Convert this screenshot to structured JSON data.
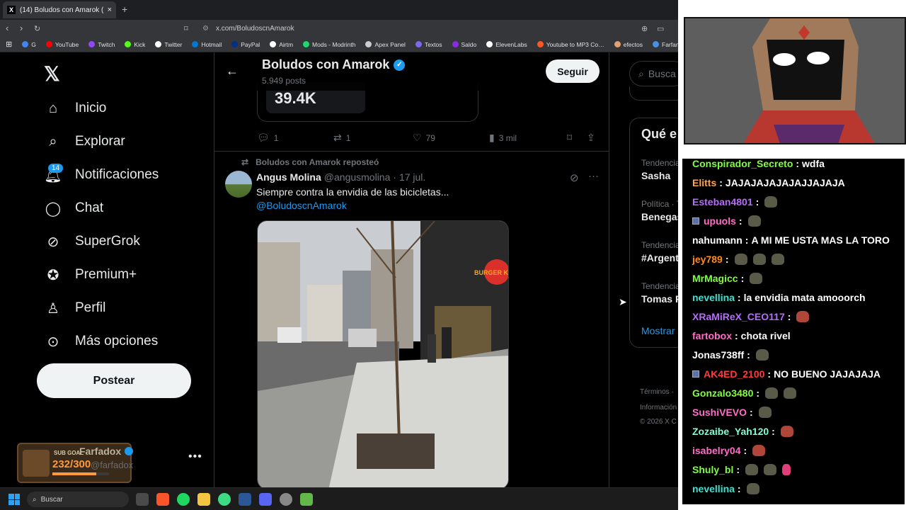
{
  "browser": {
    "tab_title": "(14) Boludos con Amarok (@Bol…",
    "tab_close": "×",
    "new_tab": "+",
    "url": "x.com/BoludoscnAmarok",
    "bookmarks": [
      {
        "label": "G",
        "color": "#4285f4"
      },
      {
        "label": "YouTube",
        "color": "#ff0000"
      },
      {
        "label": "Twitch",
        "color": "#9146ff"
      },
      {
        "label": "Kick",
        "color": "#53fc18"
      },
      {
        "label": "Twitter",
        "color": "#ffffff"
      },
      {
        "label": "Hotmail",
        "color": "#0078d4"
      },
      {
        "label": "PayPal",
        "color": "#003087"
      },
      {
        "label": "Airtm",
        "color": "#ffffff"
      },
      {
        "label": "Mods - Modrinth",
        "color": "#1bd96a"
      },
      {
        "label": "Apex Panel",
        "color": "#cccccc"
      },
      {
        "label": "Textos",
        "color": "#7b68ee"
      },
      {
        "label": "Saldo",
        "color": "#8a2be2"
      },
      {
        "label": "ElevenLabs",
        "color": "#ffffff"
      },
      {
        "label": "Youtube to MP3 Co…",
        "color": "#ff5722"
      },
      {
        "label": "efectos",
        "color": "#e0a070"
      },
      {
        "label": "Farfania Panel",
        "color": "#4a90e2"
      }
    ]
  },
  "x": {
    "nav": [
      {
        "label": "Inicio",
        "icon": "home-icon"
      },
      {
        "label": "Explorar",
        "icon": "search-icon"
      },
      {
        "label": "Notificaciones",
        "icon": "bell-icon"
      },
      {
        "label": "Chat",
        "icon": "chat-icon"
      },
      {
        "label": "SuperGrok",
        "icon": "grok-icon"
      },
      {
        "label": "Premium+",
        "icon": "verified-icon"
      },
      {
        "label": "Perfil",
        "icon": "person-icon"
      },
      {
        "label": "Más opciones",
        "icon": "more-circle-icon"
      }
    ],
    "notif_count": "14",
    "post_button": "Postear",
    "account": {
      "name": "Farfadox",
      "handle": "@farfadox",
      "sub_goal": "SUB GOAL",
      "progress_text": "232/300",
      "progress": 0.773
    },
    "header": {
      "name": "Boludos con Amarok",
      "posts": "5.949 posts",
      "follow": "Seguir"
    },
    "stat_value": "39.4K",
    "actions": {
      "replies": "1",
      "reposts": "1",
      "likes": "79",
      "views": "3 mil"
    },
    "repost_label": "Boludos con Amarok reposteó",
    "post": {
      "author": "Angus Molina",
      "handle": "@angusmolina",
      "date": "· 17 jul.",
      "text": "Siempre contra la envidia de las bicicletas...",
      "mention": "@BoludoscnAmarok",
      "sign": "BURGER KING"
    },
    "right": {
      "search_placeholder": "Busca",
      "trends_title": "Qué e",
      "trends": [
        {
          "context": "Tendencia",
          "name": "Sasha"
        },
        {
          "context": "Política · T",
          "name": "Benegas"
        },
        {
          "context": "Tendencia",
          "name": "#Argent"
        },
        {
          "context": "Tendencia",
          "name": "Tomas F"
        }
      ],
      "show_more": "Mostrar",
      "footer1": "Términos ·",
      "footer2": "Información",
      "footer3": "© 2026 X C"
    }
  },
  "taskbar": {
    "search": "Buscar"
  },
  "chat": [
    {
      "user": "Conspirador_Secreto",
      "color": "#7fff3f",
      "text": "wdfa",
      "emotes": 0
    },
    {
      "user": "Elitts",
      "color": "#ffa54f",
      "text": "JAJAJAJAJAJAJJAJAJA",
      "emotes": 0
    },
    {
      "user": "Esteban4801",
      "color": "#b86aff",
      "text": "",
      "emotes": 1
    },
    {
      "user": "upuols",
      "color": "#ff6ec7",
      "text": "",
      "emotes": 1,
      "mod": true
    },
    {
      "user": "nahumann",
      "color": "#ffffff",
      "text": "A MI ME USTA MAS LA TORO",
      "emotes": 0
    },
    {
      "user": "jey789",
      "color": "#ff8c1a",
      "text": "",
      "emotes": 3
    },
    {
      "user": "MrMagicc",
      "color": "#7fff3f",
      "text": "",
      "emotes": 1
    },
    {
      "user": "nevellina",
      "color": "#40e0d0",
      "text": "la envidia mata amooorch",
      "emotes": 0
    },
    {
      "user": "XRaMiReX_CEO117",
      "color": "#b86aff",
      "text": "",
      "emotes": 1,
      "red": true
    },
    {
      "user": "fartobox",
      "color": "#ff6ec7",
      "text": "chota rivel",
      "emotes": 0
    },
    {
      "user": "Jonas738ff",
      "color": "#ffffff",
      "text": "",
      "emotes": 1
    },
    {
      "user": "AK4ED_2100",
      "color": "#ff3b3b",
      "text": "NO BUENO JAJAJAJA",
      "emotes": 0,
      "mod": true
    },
    {
      "user": "Gonzalo3480",
      "color": "#7fff3f",
      "text": "",
      "emotes": 2
    },
    {
      "user": "SushiVEVO",
      "color": "#ff6ec7",
      "text": "",
      "emotes": 1
    },
    {
      "user": "Zozaibe_Yah120",
      "color": "#7fffd4",
      "text": "",
      "emotes": 1,
      "red": true
    },
    {
      "user": "isabelry04",
      "color": "#ff6ec7",
      "text": "",
      "emotes": 1,
      "red": true
    },
    {
      "user": "Shuly_bl",
      "color": "#7fff3f",
      "text": "",
      "emotes": 2,
      "pink": true
    },
    {
      "user": "nevellina",
      "color": "#40e0d0",
      "text": "",
      "emotes": 1
    }
  ]
}
